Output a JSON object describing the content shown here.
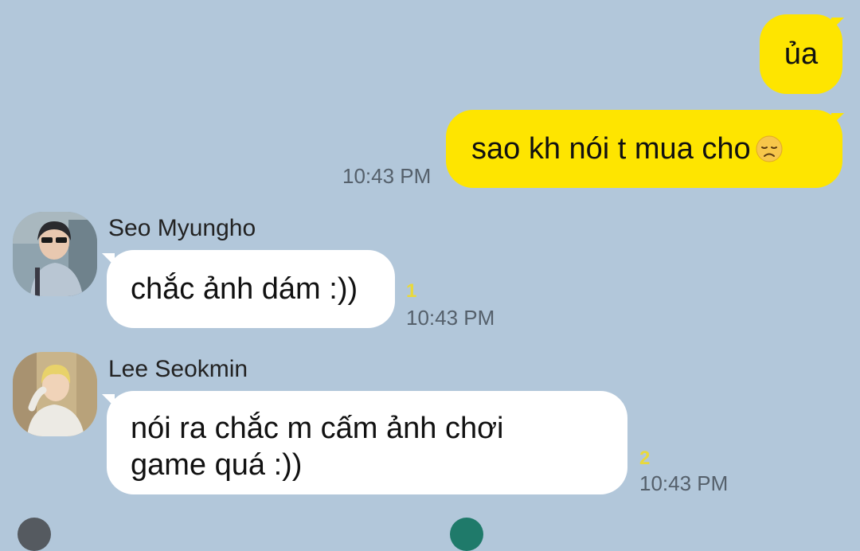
{
  "colors": {
    "background": "#b2c7da",
    "outgoing_bubble": "#fee500",
    "incoming_bubble": "#ffffff",
    "unread_count": "#e9d93a",
    "timestamp": "#55606b"
  },
  "messages": {
    "out1": {
      "text": "ủa"
    },
    "out2": {
      "text": "sao kh nói t mua cho",
      "emoji": "disappointed-face-icon",
      "time": "10:43 PM"
    },
    "in1": {
      "sender": "Seo Myungho",
      "avatar": "person-photo-avatar",
      "text": "chắc ảnh dám :))",
      "unread": "1",
      "time": "10:43 PM"
    },
    "in2": {
      "sender": "Lee Seokmin",
      "avatar": "person-photo-avatar",
      "text_line1": "nói ra chắc m cấm ảnh chơi",
      "text_line2": "game quá :))",
      "unread": "2",
      "time": "10:43 PM"
    }
  }
}
